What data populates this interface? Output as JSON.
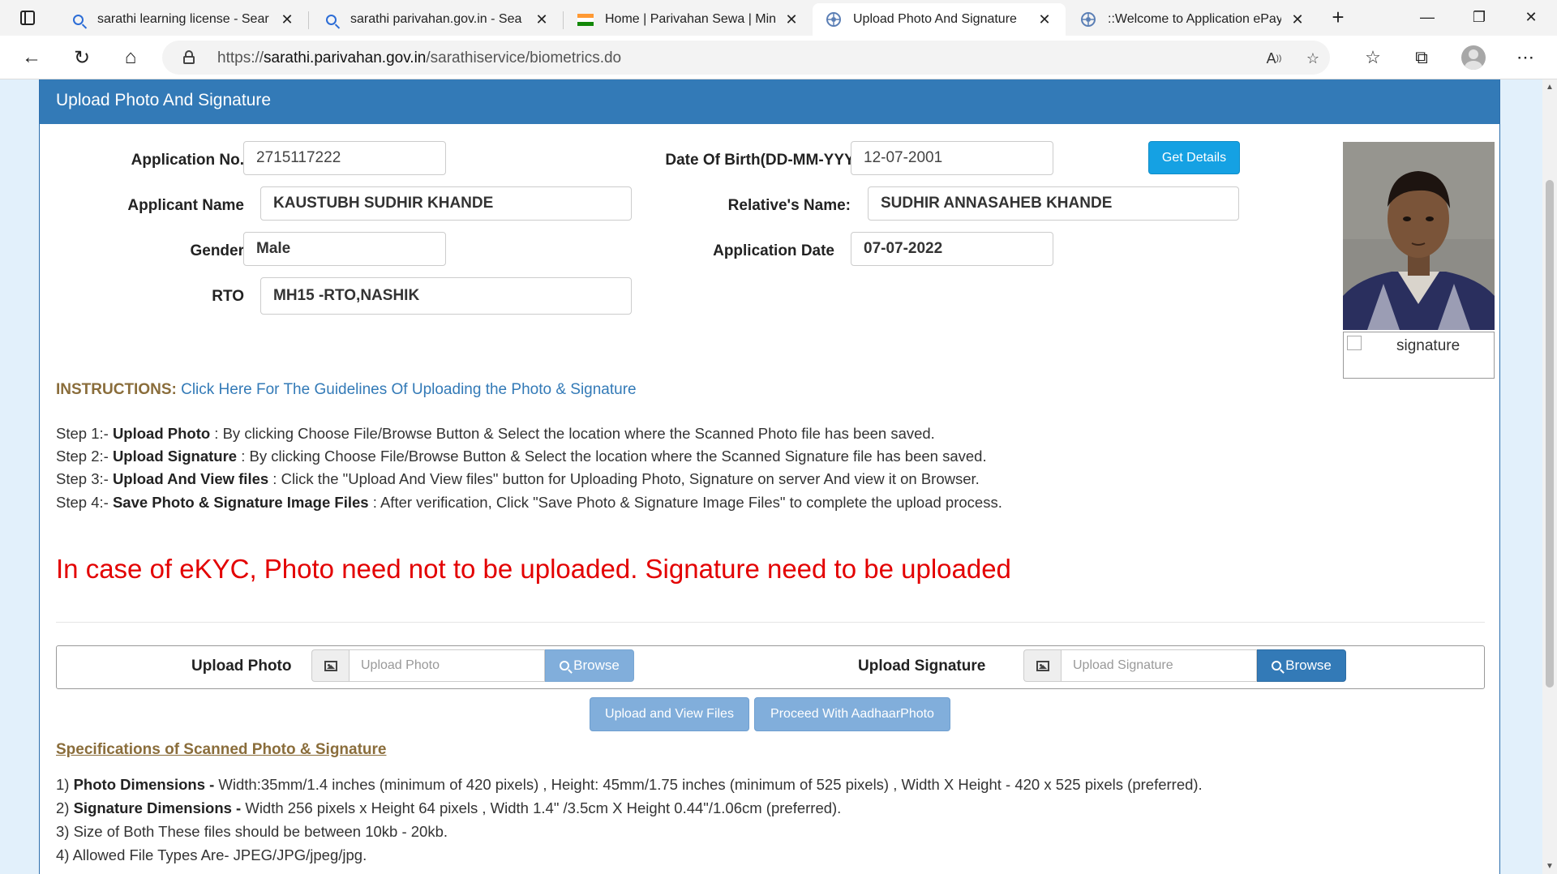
{
  "browser": {
    "tabs": [
      {
        "title": "sarathi learning license - Sear",
        "favicon": "search-icon"
      },
      {
        "title": "sarathi parivahan.gov.in - Sea",
        "favicon": "search-icon"
      },
      {
        "title": "Home | Parivahan Sewa | Mini",
        "favicon": "india-flag-icon"
      },
      {
        "title": "Upload Photo And Signature",
        "favicon": "parivahan-icon",
        "active": true
      },
      {
        "title": "::Welcome to Application ePay",
        "favicon": "parivahan-icon"
      }
    ],
    "url_prefix": "https://",
    "url_host": "sarathi.parivahan.gov.in",
    "url_path": "/sarathiservice/biometrics.do"
  },
  "page": {
    "panel_title": "Upload Photo And Signature",
    "fields": {
      "application_no_label": "Application No.",
      "application_no_value": "2715117222",
      "dob_label": "Date Of Birth(DD-MM-YYYY):",
      "dob_value": "12-07-2001",
      "get_details_label": "Get Details",
      "applicant_name_label": "Applicant Name",
      "applicant_name_value": "KAUSTUBH SUDHIR KHANDE",
      "relative_name_label": "Relative's Name:",
      "relative_name_value": "SUDHIR ANNASAHEB KHANDE",
      "gender_label": "Gender",
      "gender_value": "Male",
      "application_date_label": "Application Date",
      "application_date_value": "07-07-2022",
      "rto_label": "RTO",
      "rto_value": "MH15 -RTO,NASHIK"
    },
    "signature_alt": "signature",
    "instructions_key": "INSTRUCTIONS:",
    "instructions_link": "Click Here For The Guidelines Of Uploading the Photo & Signature",
    "steps": [
      {
        "prefix": "Step 1:- ",
        "bold": "Upload Photo",
        "text": " : By clicking Choose File/Browse Button & Select the location where the Scanned Photo file has been saved."
      },
      {
        "prefix": "Step 2:- ",
        "bold": "Upload Signature",
        "text": " : By clicking Choose File/Browse Button & Select the location where the Scanned Signature file has been saved."
      },
      {
        "prefix": "Step 3:- ",
        "bold": "Upload And View files",
        "text": " : Click the \"Upload And View files\" button for Uploading Photo, Signature on server And view it on Browser."
      },
      {
        "prefix": "Step 4:- ",
        "bold": "Save Photo & Signature Image Files",
        "text": " : After verification, Click \"Save Photo & Signature Image Files\" to complete the upload process."
      }
    ],
    "ekyc_warning": "In case of eKYC, Photo need not to be uploaded. Signature need to be uploaded",
    "upload": {
      "photo_label": "Upload Photo",
      "photo_placeholder": "Upload Photo",
      "photo_browse": "Browse",
      "signature_label": "Upload Signature",
      "signature_placeholder": "Upload Signature",
      "signature_browse": "Browse"
    },
    "actions": {
      "upload_view": "Upload and View Files",
      "proceed_aadhaar": "Proceed With AadhaarPhoto"
    },
    "spec_title": "Specifications of Scanned Photo & Signature",
    "specs": [
      {
        "prefix": "1) ",
        "bold": "Photo Dimensions -",
        "text": " Width:35mm/1.4 inches (minimum of 420 pixels) , Height: 45mm/1.75 inches (minimum of 525 pixels) , Width X Height - 420 x 525 pixels (preferred)."
      },
      {
        "prefix": "2) ",
        "bold": "Signature Dimensions -",
        "text": " Width 256 pixels x Height 64 pixels , Width 1.4\" /3.5cm X Height 0.44\"/1.06cm (preferred)."
      },
      {
        "prefix": "3) ",
        "bold": "",
        "text": "Size of Both These files should be between 10kb - 20kb."
      },
      {
        "prefix": "4) ",
        "bold": "",
        "text": "Allowed File Types Are- JPEG/JPG/jpeg/jpg."
      }
    ],
    "colors": {
      "header": "#337ab7",
      "warning": "#e30000",
      "accent_label": "#8a6d3b",
      "get_details": "#15a1e3"
    }
  }
}
